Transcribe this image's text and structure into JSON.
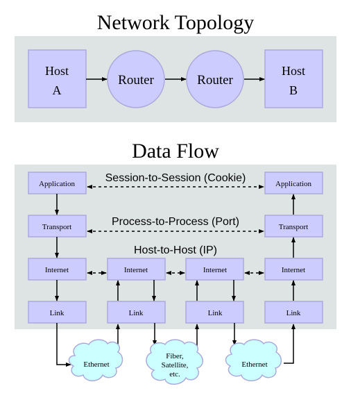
{
  "topology": {
    "title": "Network Topology",
    "nodes": [
      {
        "label_line1": "Host",
        "label_line2": "A"
      },
      {
        "label": "Router"
      },
      {
        "label": "Router"
      },
      {
        "label_line1": "Host",
        "label_line2": "B"
      }
    ]
  },
  "dataflow": {
    "title": "Data Flow",
    "peer_labels": {
      "session": "Session-to-Session (Cookie)",
      "process": "Process-to-Process (Port)",
      "host": "Host-to-Host (IP)"
    },
    "layers": {
      "application": "Application",
      "transport": "Transport",
      "internet": "Internet",
      "link": "Link"
    },
    "clouds": [
      {
        "label": "Ethernet"
      },
      {
        "line1": "Fiber,",
        "line2": "Satellite,",
        "line3": "etc."
      },
      {
        "label": "Ethernet"
      }
    ]
  },
  "colors": {
    "panel": "#dde4e3",
    "box_fill": "#ccccff",
    "box_stroke": "#aaaadd",
    "cloud_fill": "#ccffff",
    "cloud_stroke": "#aaaadd"
  }
}
